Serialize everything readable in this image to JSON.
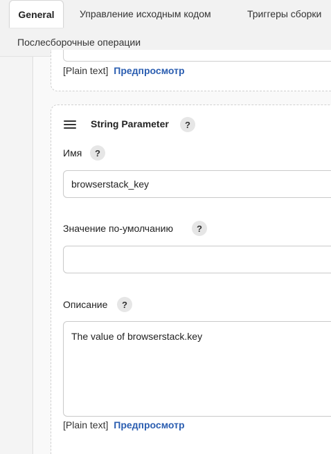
{
  "tabs": [
    {
      "label": "General",
      "active": true
    },
    {
      "label": "Управление исходным кодом",
      "active": false
    },
    {
      "label": "Триггеры сборки",
      "active": false
    },
    {
      "label": "Послесборочные операции",
      "active": false
    }
  ],
  "top_card": {
    "format_label": "[Plain text]",
    "preview_label": "Предпросмотр"
  },
  "parameter": {
    "title": "String Parameter",
    "help": "?",
    "name_label": "Имя",
    "name_value": "browserstack_key",
    "default_label": "Значение по-умолчанию",
    "default_value": "",
    "description_label": "Описание",
    "description_value": "The value of browserstack.key",
    "format_label": "[Plain text]",
    "preview_label": "Предпросмотр"
  }
}
